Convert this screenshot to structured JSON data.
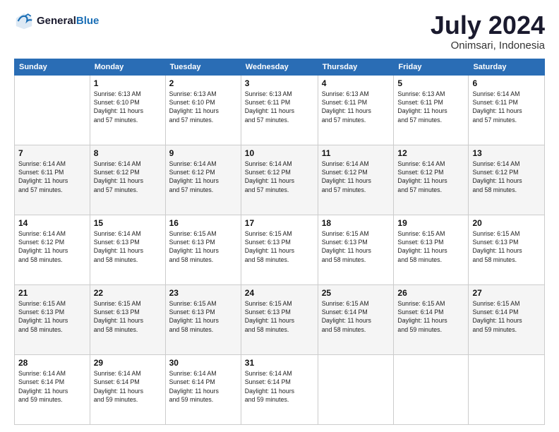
{
  "header": {
    "logo_line1": "General",
    "logo_line2": "Blue",
    "title": "July 2024",
    "subtitle": "Onimsari, Indonesia"
  },
  "weekdays": [
    "Sunday",
    "Monday",
    "Tuesday",
    "Wednesday",
    "Thursday",
    "Friday",
    "Saturday"
  ],
  "weeks": [
    [
      {
        "day": "",
        "info": ""
      },
      {
        "day": "1",
        "info": "Sunrise: 6:13 AM\nSunset: 6:10 PM\nDaylight: 11 hours\nand 57 minutes."
      },
      {
        "day": "2",
        "info": "Sunrise: 6:13 AM\nSunset: 6:10 PM\nDaylight: 11 hours\nand 57 minutes."
      },
      {
        "day": "3",
        "info": "Sunrise: 6:13 AM\nSunset: 6:11 PM\nDaylight: 11 hours\nand 57 minutes."
      },
      {
        "day": "4",
        "info": "Sunrise: 6:13 AM\nSunset: 6:11 PM\nDaylight: 11 hours\nand 57 minutes."
      },
      {
        "day": "5",
        "info": "Sunrise: 6:13 AM\nSunset: 6:11 PM\nDaylight: 11 hours\nand 57 minutes."
      },
      {
        "day": "6",
        "info": "Sunrise: 6:14 AM\nSunset: 6:11 PM\nDaylight: 11 hours\nand 57 minutes."
      }
    ],
    [
      {
        "day": "7",
        "info": "Sunrise: 6:14 AM\nSunset: 6:11 PM\nDaylight: 11 hours\nand 57 minutes."
      },
      {
        "day": "8",
        "info": "Sunrise: 6:14 AM\nSunset: 6:12 PM\nDaylight: 11 hours\nand 57 minutes."
      },
      {
        "day": "9",
        "info": "Sunrise: 6:14 AM\nSunset: 6:12 PM\nDaylight: 11 hours\nand 57 minutes."
      },
      {
        "day": "10",
        "info": "Sunrise: 6:14 AM\nSunset: 6:12 PM\nDaylight: 11 hours\nand 57 minutes."
      },
      {
        "day": "11",
        "info": "Sunrise: 6:14 AM\nSunset: 6:12 PM\nDaylight: 11 hours\nand 57 minutes."
      },
      {
        "day": "12",
        "info": "Sunrise: 6:14 AM\nSunset: 6:12 PM\nDaylight: 11 hours\nand 57 minutes."
      },
      {
        "day": "13",
        "info": "Sunrise: 6:14 AM\nSunset: 6:12 PM\nDaylight: 11 hours\nand 58 minutes."
      }
    ],
    [
      {
        "day": "14",
        "info": "Sunrise: 6:14 AM\nSunset: 6:12 PM\nDaylight: 11 hours\nand 58 minutes."
      },
      {
        "day": "15",
        "info": "Sunrise: 6:14 AM\nSunset: 6:13 PM\nDaylight: 11 hours\nand 58 minutes."
      },
      {
        "day": "16",
        "info": "Sunrise: 6:15 AM\nSunset: 6:13 PM\nDaylight: 11 hours\nand 58 minutes."
      },
      {
        "day": "17",
        "info": "Sunrise: 6:15 AM\nSunset: 6:13 PM\nDaylight: 11 hours\nand 58 minutes."
      },
      {
        "day": "18",
        "info": "Sunrise: 6:15 AM\nSunset: 6:13 PM\nDaylight: 11 hours\nand 58 minutes."
      },
      {
        "day": "19",
        "info": "Sunrise: 6:15 AM\nSunset: 6:13 PM\nDaylight: 11 hours\nand 58 minutes."
      },
      {
        "day": "20",
        "info": "Sunrise: 6:15 AM\nSunset: 6:13 PM\nDaylight: 11 hours\nand 58 minutes."
      }
    ],
    [
      {
        "day": "21",
        "info": "Sunrise: 6:15 AM\nSunset: 6:13 PM\nDaylight: 11 hours\nand 58 minutes."
      },
      {
        "day": "22",
        "info": "Sunrise: 6:15 AM\nSunset: 6:13 PM\nDaylight: 11 hours\nand 58 minutes."
      },
      {
        "day": "23",
        "info": "Sunrise: 6:15 AM\nSunset: 6:13 PM\nDaylight: 11 hours\nand 58 minutes."
      },
      {
        "day": "24",
        "info": "Sunrise: 6:15 AM\nSunset: 6:13 PM\nDaylight: 11 hours\nand 58 minutes."
      },
      {
        "day": "25",
        "info": "Sunrise: 6:15 AM\nSunset: 6:14 PM\nDaylight: 11 hours\nand 58 minutes."
      },
      {
        "day": "26",
        "info": "Sunrise: 6:15 AM\nSunset: 6:14 PM\nDaylight: 11 hours\nand 59 minutes."
      },
      {
        "day": "27",
        "info": "Sunrise: 6:15 AM\nSunset: 6:14 PM\nDaylight: 11 hours\nand 59 minutes."
      }
    ],
    [
      {
        "day": "28",
        "info": "Sunrise: 6:14 AM\nSunset: 6:14 PM\nDaylight: 11 hours\nand 59 minutes."
      },
      {
        "day": "29",
        "info": "Sunrise: 6:14 AM\nSunset: 6:14 PM\nDaylight: 11 hours\nand 59 minutes."
      },
      {
        "day": "30",
        "info": "Sunrise: 6:14 AM\nSunset: 6:14 PM\nDaylight: 11 hours\nand 59 minutes."
      },
      {
        "day": "31",
        "info": "Sunrise: 6:14 AM\nSunset: 6:14 PM\nDaylight: 11 hours\nand 59 minutes."
      },
      {
        "day": "",
        "info": ""
      },
      {
        "day": "",
        "info": ""
      },
      {
        "day": "",
        "info": ""
      }
    ]
  ]
}
